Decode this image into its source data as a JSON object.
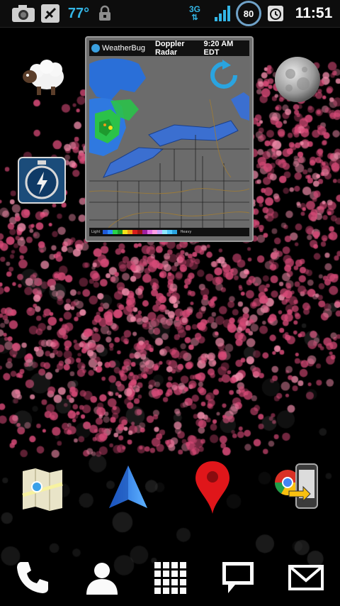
{
  "status_bar": {
    "temperature": "77°",
    "network": "3G",
    "battery_level": "80",
    "time": "11:51",
    "icons": [
      "camera-icon",
      "usb-debug-icon",
      "lock-icon",
      "signal-icon",
      "alarm-icon"
    ]
  },
  "weather_widget": {
    "brand": "WeatherBug",
    "title": "Doppler Radar",
    "time": "9:20 AM EDT",
    "refresh_icon": "refresh-icon",
    "legend_left": "Light",
    "legend_right": "Heavy",
    "legend_colors": [
      "#1e5ad8",
      "#2d8bff",
      "#28d34a",
      "#1d9c2c",
      "#f5e21a",
      "#f29b17",
      "#d81c1c",
      "#9a1313",
      "#a020a0",
      "#e36ce3",
      "#ff9ee6",
      "#c7a4ff",
      "#8fe8ff",
      "#52c9ff",
      "#2aa4e0"
    ]
  },
  "home_icons": {
    "row1": [
      "sheep-icon",
      "moon-icon"
    ],
    "row2": [
      "stopwatch-icon"
    ],
    "row3": [
      "maps-icon",
      "navigation-icon",
      "places-icon",
      "chrome-to-phone-icon"
    ]
  },
  "dock": [
    "phone-icon",
    "contacts-icon",
    "app-drawer-icon",
    "messaging-icon",
    "email-icon"
  ],
  "colors": {
    "accent_blue": "#33b5e5",
    "particle_pink": "#d64a77"
  }
}
